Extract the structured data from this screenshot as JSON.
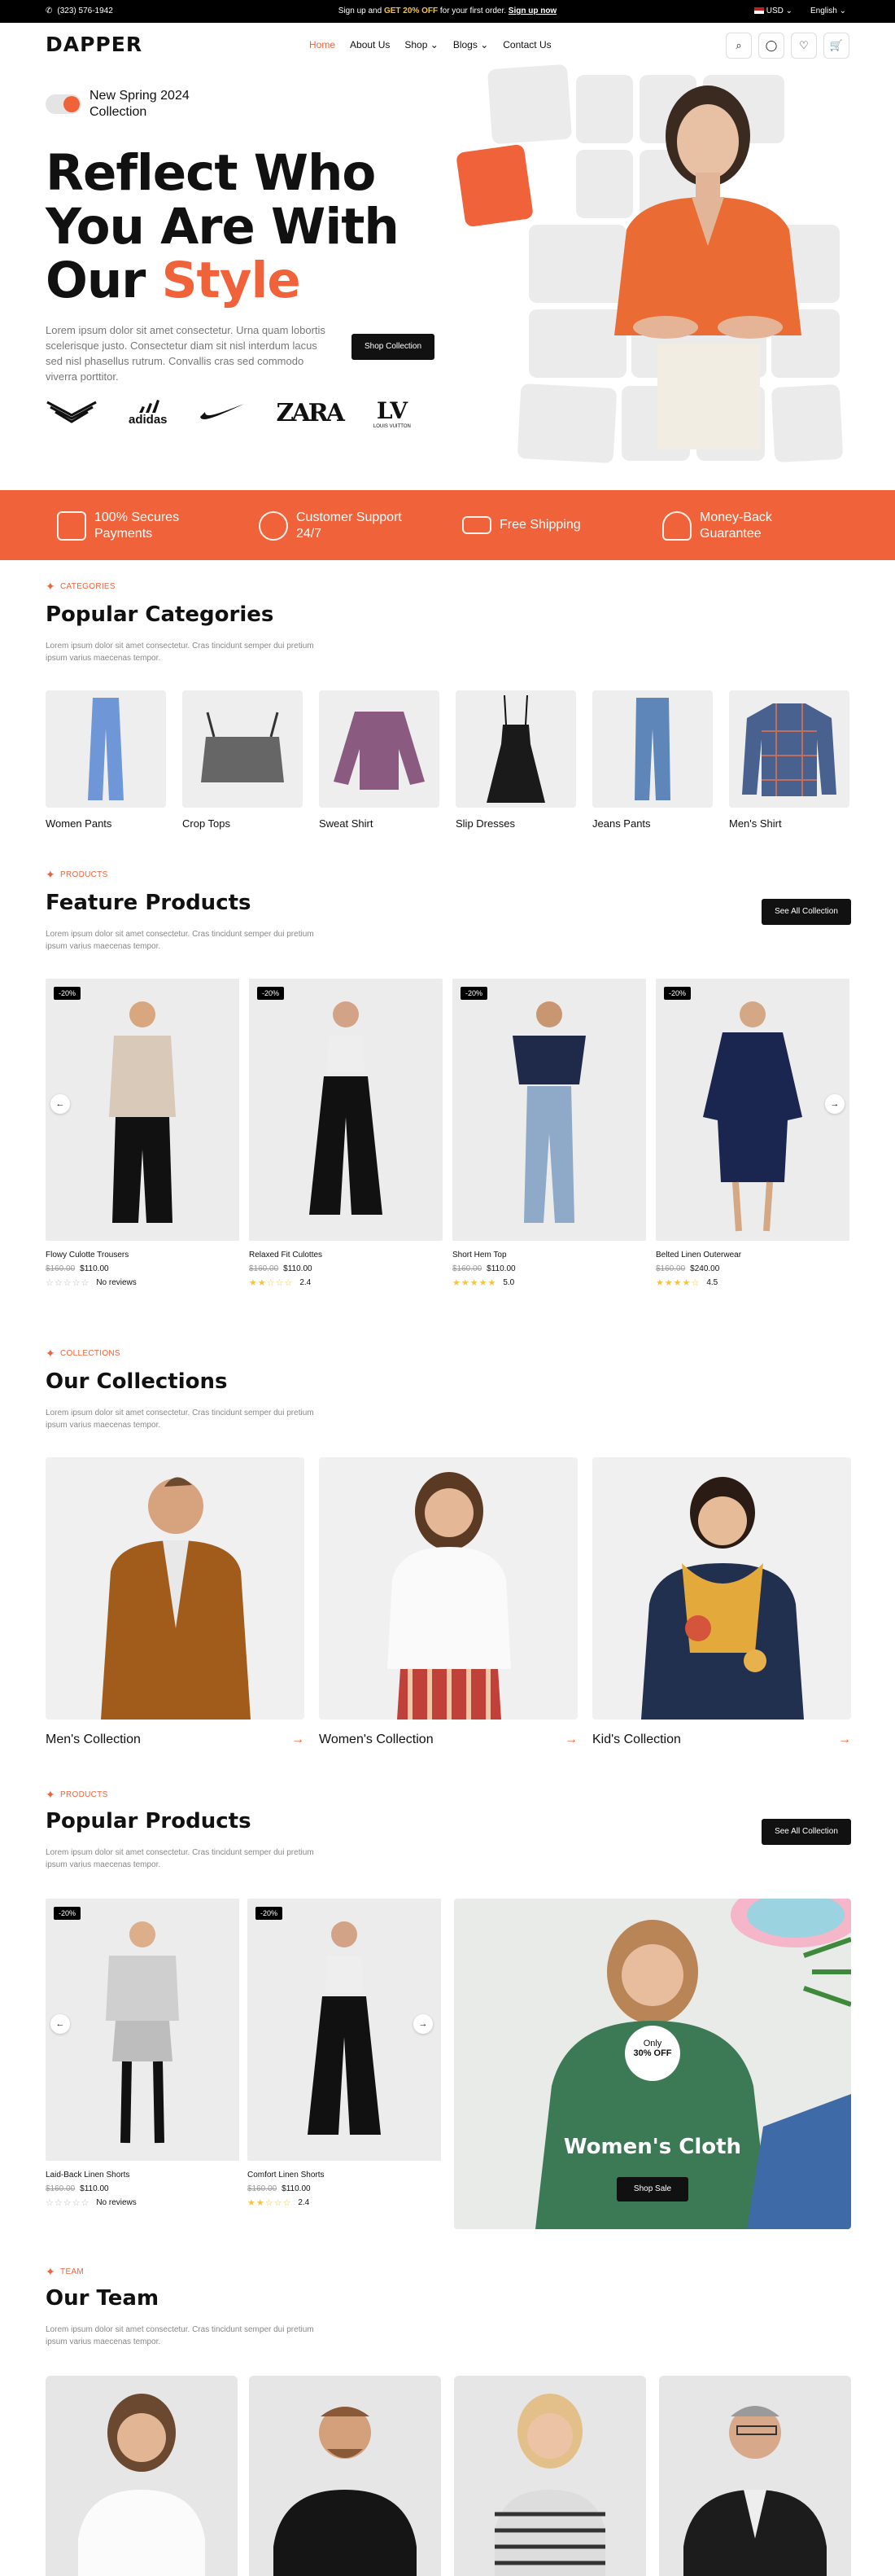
{
  "topbar": {
    "phone": "(323) 576-1942",
    "promo_pre": "Sign up and ",
    "promo_highlight": "GET 20% OFF",
    "promo_mid": " for your first order. ",
    "promo_link": "Sign up now",
    "currency": "USD",
    "language": "English"
  },
  "nav": {
    "logo": "DAPPER",
    "items": [
      "Home",
      "About Us",
      "Shop",
      "Blogs",
      "Contact Us"
    ]
  },
  "hero": {
    "tag": "New Spring 2024 Collection",
    "title_line1": "Reflect Who",
    "title_line2": "You Are With",
    "title_line3_a": "Our ",
    "title_line3_b": "Style",
    "description": "Lorem ipsum dolor sit amet consectetur. Urna quam lobortis scelerisque justo. Consectetur diam sit nisl interdum lacus sed nisl phasellus rutrum. Convallis cras sed commodo viverra porttitor.",
    "cta": "Shop Collection",
    "brands": [
      "EMPORIO ARMANI",
      "adidas",
      "NIKE",
      "ZARA",
      "LOUIS VUITTON"
    ]
  },
  "features": [
    "100% Secures Payments",
    "Customer Support 24/7",
    "Free Shipping",
    "Money-Back Guarantee"
  ],
  "categories": {
    "tag": "CATEGORIES",
    "title": "Popular Categories",
    "desc": "Lorem ipsum dolor sit amet consectetur. Cras tincidunt semper dui pretium ipsum varius maecenas tempor.",
    "items": [
      "Women Pants",
      "Crop Tops",
      "Sweat Shirt",
      "Slip Dresses",
      "Jeans Pants",
      "Men's Shirt"
    ]
  },
  "featured": {
    "tag": "PRODUCTS",
    "title": "Feature Products",
    "desc": "Lorem ipsum dolor sit amet consectetur. Cras tincidunt semper dui pretium ipsum varius maecenas tempor.",
    "button": "See All Collection",
    "products": [
      {
        "badge": "-20%",
        "name": "Flowy Culotte Trousers",
        "old": "$160.00",
        "price": "$110.00",
        "stars": "☆☆☆☆☆",
        "rating": "No reviews"
      },
      {
        "badge": "-20%",
        "name": "Relaxed Fit Culottes",
        "old": "$160.00",
        "price": "$110.00",
        "stars": "★★☆☆☆",
        "rating": "2.4"
      },
      {
        "badge": "-20%",
        "name": "Short Hem Top",
        "old": "$160.00",
        "price": "$110.00",
        "stars": "★★★★★",
        "rating": "5.0"
      },
      {
        "badge": "-20%",
        "name": "Belted Linen Outerwear",
        "old": "$160.00",
        "price": "$240.00",
        "stars": "★★★★☆",
        "rating": "4.5"
      }
    ]
  },
  "collections": {
    "tag": "COLLECTIONS",
    "title": "Our Collections",
    "desc": "Lorem ipsum dolor sit amet consectetur. Cras tincidunt semper dui pretium ipsum varius maecenas tempor.",
    "items": [
      "Men's Collection",
      "Women's Collection",
      "Kid's Collection"
    ],
    "arrow": "→"
  },
  "popular": {
    "tag": "PRODUCTS",
    "title": "Popular Products",
    "desc": "Lorem ipsum dolor sit amet consectetur. Cras tincidunt semper dui pretium ipsum varius maecenas tempor.",
    "button": "See All Collection",
    "products": [
      {
        "badge": "-20%",
        "name": "Laid-Back Linen Shorts",
        "old": "$160.00",
        "price": "$110.00",
        "stars": "☆☆☆☆☆",
        "rating": "No reviews"
      },
      {
        "badge": "-20%",
        "name": "Comfort Linen Shorts",
        "old": "$160.00",
        "price": "$110.00",
        "stars": "★★☆☆☆",
        "rating": "2.4"
      }
    ],
    "promo": {
      "only": "Only",
      "off": "30% OFF",
      "title": "Women's Cloth",
      "button": "Shop Sale"
    }
  },
  "team": {
    "tag": "TEAM",
    "title": "Our Team",
    "desc": "Lorem ipsum dolor sit amet consectetur. Cras tincidunt semper dui pretium ipsum varius maecenas tempor."
  },
  "colors": {
    "accent": "#f0633a",
    "dark": "#111111",
    "star": "#f6c343"
  }
}
